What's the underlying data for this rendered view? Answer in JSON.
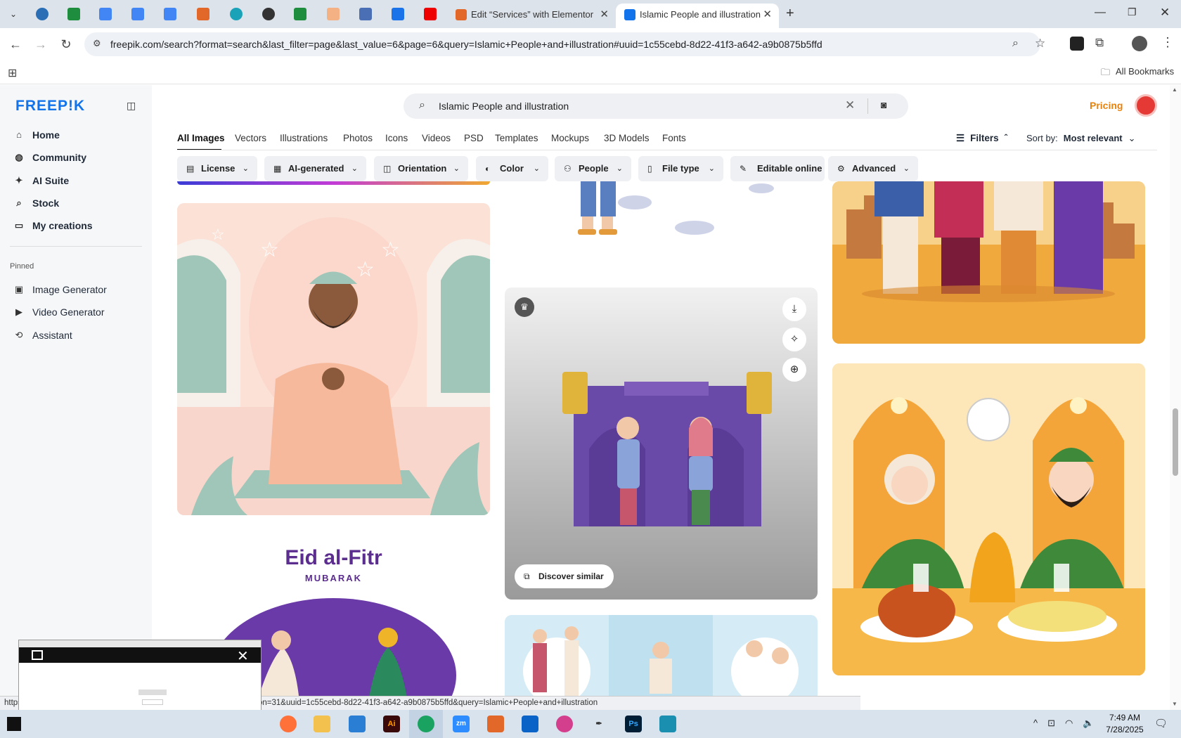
{
  "browser": {
    "tabs": [
      {
        "title": "Edit “Services” with Elementor",
        "active": false
      },
      {
        "title": "Islamic People and illustration",
        "active": true
      }
    ],
    "new_tab": "+",
    "url": "freepik.com/search?format=search&last_filter=page&last_value=6&page=6&query=Islamic+People+and+illustration#uuid=1c55cebd-8d22-41f3-a642-a9b0875b5ffd",
    "all_bookmarks": "All Bookmarks",
    "status_url": "https://... de-mosque_55892472.htm#fromView=search&page=6&position=31&uuid=1c55cebd-8d22-41f3-a642-a9b0875b5ffd&query=Islamic+People+and+illustration"
  },
  "sidebar": {
    "logo": "FREEP!K",
    "items": [
      {
        "label": "Home"
      },
      {
        "label": "Community"
      },
      {
        "label": "AI Suite"
      },
      {
        "label": "Stock"
      },
      {
        "label": "My creations"
      }
    ],
    "pinned_label": "Pinned",
    "pinned": [
      {
        "label": "Image Generator"
      },
      {
        "label": "Video Generator"
      },
      {
        "label": "Assistant"
      }
    ]
  },
  "search": {
    "query": "Islamic People and illustration"
  },
  "header": {
    "pricing": "Pricing"
  },
  "content_tabs": [
    "All Images",
    "Vectors",
    "Illustrations",
    "Photos",
    "Icons",
    "Videos",
    "PSD",
    "Templates",
    "Mockups",
    "3D Models",
    "Fonts"
  ],
  "filters_label": "Filters",
  "sort": {
    "label": "Sort by:",
    "value": "Most relevant"
  },
  "chips": [
    "License",
    "AI-generated",
    "Orientation",
    "Color",
    "People",
    "File type",
    "Editable online",
    "Advanced"
  ],
  "cards": {
    "eid_title": "Eid al-Fitr",
    "eid_subtitle": "MUBARAK",
    "discover_similar": "Discover similar"
  },
  "taskbar": {
    "time": "7:49 AM",
    "date": "7/28/2025"
  },
  "colors": {
    "brand": "#1273eb",
    "pricing": "#e8820c",
    "eid_purple": "#5b2d8e"
  }
}
